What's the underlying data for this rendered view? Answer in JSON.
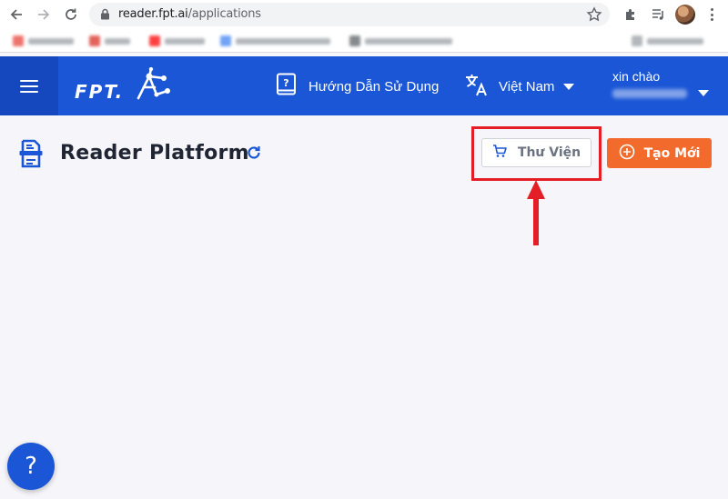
{
  "browser": {
    "url_host": "reader.fpt.ai",
    "url_path": "/applications"
  },
  "header": {
    "logo_text": "FPT.AI",
    "guide_label": "Hướng Dẫn Sử Dụng",
    "language_label": "Việt Nam",
    "greeting": "xin chào"
  },
  "page": {
    "title": "Reader Platform",
    "library_button": "Thư Viện",
    "create_button": "Tạo Mới",
    "help_label": "?"
  },
  "colors": {
    "brand_blue": "#1a56d6",
    "accent_orange": "#f26b2c",
    "highlight_red": "#e41e26"
  },
  "icons": [
    "back-arrow-icon",
    "forward-arrow-icon",
    "reload-icon",
    "lock-icon",
    "star-icon",
    "puzzle-icon",
    "media-icon",
    "menu-icon",
    "book-question-icon",
    "translate-icon",
    "document-icon",
    "refresh-icon",
    "cart-icon",
    "plus-circle-icon",
    "help-icon"
  ]
}
